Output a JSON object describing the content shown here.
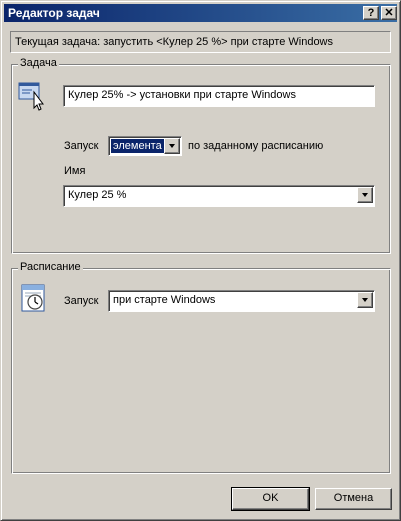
{
  "window": {
    "title": "Редактор задач",
    "help_label": "?",
    "close_label": "✕"
  },
  "current_task": "Текущая задача: запустить <Кулер 25 %> при старте Windows",
  "task_group": {
    "legend": "Задача",
    "icon": "task-cursor-icon",
    "description_value": "Кулер 25% -> установки при старте Windows",
    "launch_label": "Запуск",
    "launch_type_value": "элемента",
    "schedule_suffix": "по заданному расписанию",
    "name_label": "Имя",
    "name_value": "Кулер 25 %"
  },
  "schedule_group": {
    "legend": "Расписание",
    "icon": "clock-calendar-icon",
    "launch_label": "Запуск",
    "launch_value": "при старте Windows"
  },
  "buttons": {
    "ok": "OK",
    "cancel": "Отмена"
  },
  "colors": {
    "titlebar_start": "#0a246a",
    "titlebar_end": "#3a6ea5",
    "face": "#d4d0c8",
    "selection": "#0a246a"
  }
}
